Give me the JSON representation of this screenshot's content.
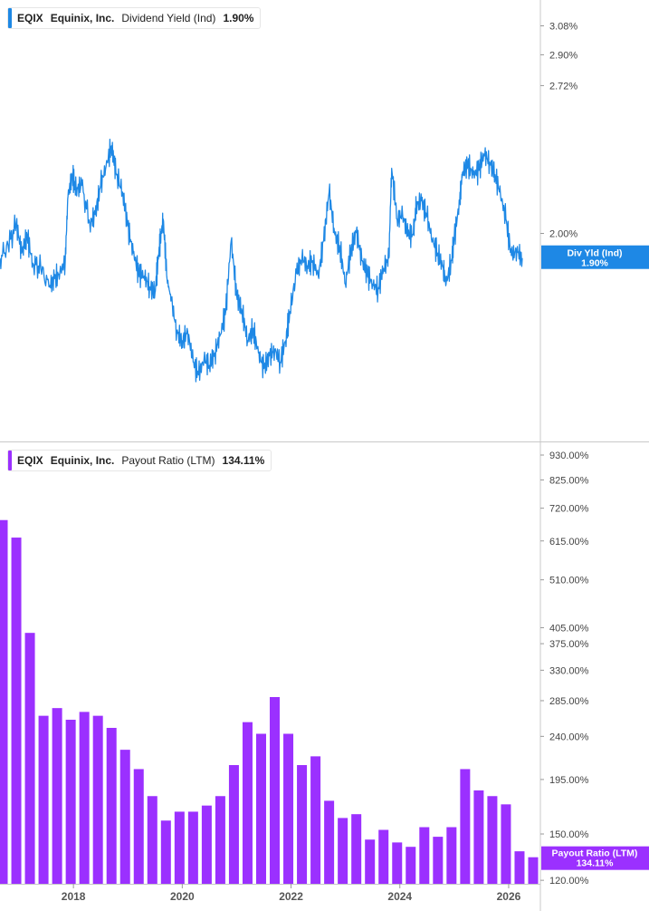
{
  "legend_top": {
    "ticker": "EQIX",
    "company": "Equinix, Inc.",
    "metric": "Dividend Yield (Ind)",
    "value": "1.90%",
    "color": "#1e88e5"
  },
  "legend_bottom": {
    "ticker": "EQIX",
    "company": "Equinix, Inc.",
    "metric": "Payout Ratio (LTM)",
    "value": "134.11%",
    "color": "#9b30ff"
  },
  "chart_data": [
    {
      "type": "line",
      "title": "EQIX Equinix, Inc. Dividend Yield (Ind) 1.90%",
      "color": "#1e88e5",
      "y_scale": "log",
      "ylim": [
        1.3,
        3.25
      ],
      "y_ticks": [
        "3.08%",
        "2.90%",
        "2.72%",
        "2.00%"
      ],
      "y_tick_values": [
        3.08,
        2.9,
        2.72,
        2.0
      ],
      "last_value_label": [
        "Div Yld (Ind)",
        "1.90%"
      ],
      "last_value": 1.9,
      "x_range": [
        2016.65,
        2026.5
      ],
      "series": [
        {
          "values": [
            [
              2016.65,
              1.9
            ],
            [
              2016.8,
              1.95
            ],
            [
              2016.95,
              2.04
            ],
            [
              2017.05,
              1.92
            ],
            [
              2017.15,
              1.99
            ],
            [
              2017.25,
              1.88
            ],
            [
              2017.4,
              1.86
            ],
            [
              2017.55,
              1.79
            ],
            [
              2017.65,
              1.82
            ],
            [
              2017.75,
              1.84
            ],
            [
              2017.85,
              1.89
            ],
            [
              2017.9,
              2.16
            ],
            [
              2017.98,
              2.26
            ],
            [
              2018.05,
              2.19
            ],
            [
              2018.15,
              2.21
            ],
            [
              2018.3,
              2.04
            ],
            [
              2018.4,
              2.08
            ],
            [
              2018.5,
              2.21
            ],
            [
              2018.6,
              2.3
            ],
            [
              2018.7,
              2.4
            ],
            [
              2018.78,
              2.27
            ],
            [
              2018.9,
              2.18
            ],
            [
              2019.0,
              2.03
            ],
            [
              2019.1,
              1.92
            ],
            [
              2019.2,
              1.84
            ],
            [
              2019.3,
              1.83
            ],
            [
              2019.4,
              1.79
            ],
            [
              2019.5,
              1.77
            ],
            [
              2019.55,
              1.88
            ],
            [
              2019.6,
              1.98
            ],
            [
              2019.65,
              2.06
            ],
            [
              2019.72,
              1.82
            ],
            [
              2019.8,
              1.74
            ],
            [
              2019.9,
              1.63
            ],
            [
              2020.0,
              1.6
            ],
            [
              2020.1,
              1.63
            ],
            [
              2020.2,
              1.53
            ],
            [
              2020.3,
              1.49
            ],
            [
              2020.4,
              1.54
            ],
            [
              2020.5,
              1.52
            ],
            [
              2020.6,
              1.56
            ],
            [
              2020.7,
              1.62
            ],
            [
              2020.8,
              1.7
            ],
            [
              2020.9,
              1.97
            ],
            [
              2021.0,
              1.76
            ],
            [
              2021.1,
              1.7
            ],
            [
              2021.2,
              1.6
            ],
            [
              2021.3,
              1.64
            ],
            [
              2021.4,
              1.56
            ],
            [
              2021.5,
              1.51
            ],
            [
              2021.6,
              1.55
            ],
            [
              2021.7,
              1.57
            ],
            [
              2021.8,
              1.53
            ],
            [
              2021.9,
              1.6
            ],
            [
              2021.98,
              1.7
            ],
            [
              2022.1,
              1.84
            ],
            [
              2022.2,
              1.9
            ],
            [
              2022.3,
              1.87
            ],
            [
              2022.4,
              1.89
            ],
            [
              2022.5,
              1.83
            ],
            [
              2022.6,
              1.97
            ],
            [
              2022.7,
              2.18
            ],
            [
              2022.8,
              2.0
            ],
            [
              2022.9,
              1.94
            ],
            [
              2023.0,
              1.8
            ],
            [
              2023.1,
              1.93
            ],
            [
              2023.2,
              2.01
            ],
            [
              2023.3,
              1.89
            ],
            [
              2023.4,
              1.84
            ],
            [
              2023.5,
              1.8
            ],
            [
              2023.6,
              1.78
            ],
            [
              2023.7,
              1.86
            ],
            [
              2023.8,
              1.9
            ],
            [
              2023.85,
              2.29
            ],
            [
              2023.95,
              2.06
            ],
            [
              2024.05,
              2.08
            ],
            [
              2024.15,
              1.99
            ],
            [
              2024.25,
              2.0
            ],
            [
              2024.3,
              2.12
            ],
            [
              2024.4,
              2.14
            ],
            [
              2024.5,
              2.07
            ],
            [
              2024.6,
              1.97
            ],
            [
              2024.7,
              1.92
            ],
            [
              2024.8,
              1.86
            ],
            [
              2024.85,
              1.8
            ],
            [
              2024.95,
              1.89
            ],
            [
              2025.0,
              1.98
            ],
            [
              2025.1,
              2.14
            ],
            [
              2025.15,
              2.27
            ],
            [
              2025.25,
              2.31
            ],
            [
              2025.35,
              2.26
            ],
            [
              2025.45,
              2.28
            ],
            [
              2025.55,
              2.36
            ],
            [
              2025.65,
              2.32
            ],
            [
              2025.75,
              2.26
            ],
            [
              2025.85,
              2.17
            ],
            [
              2025.95,
              2.06
            ],
            [
              2026.05,
              1.91
            ],
            [
              2026.15,
              1.93
            ],
            [
              2026.25,
              1.9
            ]
          ]
        }
      ]
    },
    {
      "type": "bar",
      "title": "EQIX Equinix, Inc. Payout Ratio (LTM) 134.11%",
      "color": "#9b30ff",
      "y_scale": "log",
      "ylim": [
        118,
        980
      ],
      "y_ticks": [
        "930.00%",
        "825.00%",
        "720.00%",
        "615.00%",
        "510.00%",
        "405.00%",
        "375.00%",
        "330.00%",
        "285.00%",
        "240.00%",
        "195.00%",
        "150.00%",
        "120.00%"
      ],
      "y_tick_values": [
        930,
        825,
        720,
        615,
        510,
        405,
        375,
        330,
        285,
        240,
        195,
        150,
        120
      ],
      "last_value_label": [
        "Payout Ratio (LTM)",
        "134.11%"
      ],
      "last_value": 134.11,
      "x_ticks": [
        "2018",
        "2020",
        "2022",
        "2024",
        "2026"
      ],
      "x_tick_values": [
        2018.0,
        2020.0,
        2022.0,
        2024.0,
        2026.0
      ],
      "x_range": [
        2016.65,
        2026.5
      ],
      "x": [
        2016.7,
        2016.95,
        2017.2,
        2017.45,
        2017.7,
        2017.95,
        2018.2,
        2018.45,
        2018.7,
        2018.95,
        2019.2,
        2019.45,
        2019.7,
        2019.95,
        2020.2,
        2020.45,
        2020.7,
        2020.95,
        2021.2,
        2021.45,
        2021.7,
        2021.95,
        2022.2,
        2022.45,
        2022.7,
        2022.95,
        2023.2,
        2023.45,
        2023.7,
        2023.95,
        2024.2,
        2024.45,
        2024.7,
        2024.95,
        2025.2,
        2025.45,
        2025.7,
        2025.95,
        2026.2
      ],
      "values": [
        680,
        625,
        395,
        265,
        275,
        260,
        270,
        265,
        250,
        225,
        205,
        180,
        160,
        167,
        167,
        172,
        180,
        209,
        257,
        243,
        290,
        243,
        209,
        218,
        176,
        162,
        165,
        146,
        153,
        144,
        141,
        155,
        148,
        155,
        205,
        185,
        180,
        173,
        138,
        134.11
      ]
    }
  ]
}
